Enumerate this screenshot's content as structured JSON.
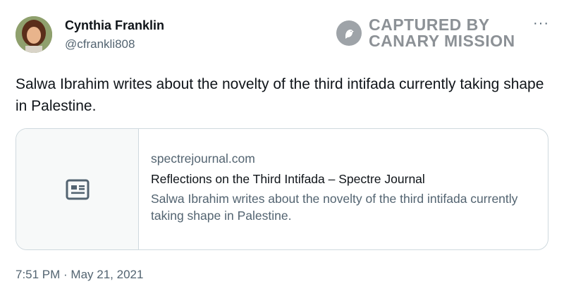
{
  "author": {
    "name": "Cynthia Franklin",
    "handle": "@cfrankli808"
  },
  "watermark": {
    "line1": "CAPTURED BY",
    "line2": "CANARY MISSION"
  },
  "more_label": "···",
  "tweet": {
    "text": "Salwa Ibrahim writes about the novelty of the third intifada currently taking shape in Palestine."
  },
  "link_card": {
    "domain": "spectrejournal.com",
    "title": "Reflections on the Third Intifada – Spectre Journal",
    "description": "Salwa Ibrahim writes about the novelty of the third intifada currently taking shape in Palestine.",
    "icon": "article-icon"
  },
  "timestamp": "7:51 PM · May 21, 2021",
  "colors": {
    "text_primary": "#0f1419",
    "text_secondary": "#536471",
    "border": "#cfd9de",
    "watermark": "#8c9196"
  }
}
